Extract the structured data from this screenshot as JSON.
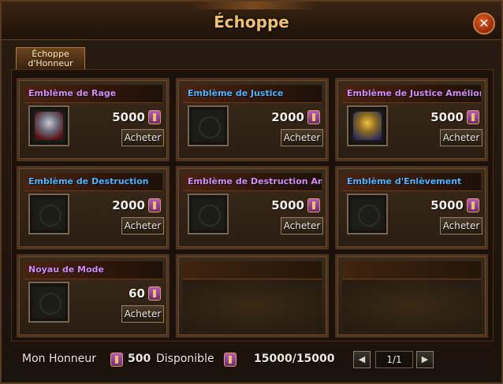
{
  "window": {
    "title": "Échoppe",
    "close_label": "✕"
  },
  "tab": {
    "line1": "Échoppe",
    "line2": "d'Honneur"
  },
  "buy_label": "Acheter",
  "items": [
    {
      "name": "Emblème de Rage",
      "color": "#d48cf8",
      "price": "5000",
      "icon": "rage-emblem-icon"
    },
    {
      "name": "Emblème de Justice",
      "color": "#4fb4ff",
      "price": "2000",
      "icon": "empty-slot-icon"
    },
    {
      "name": "Emblème de Justice Amélioré",
      "color": "#d48cf8",
      "price": "5000",
      "icon": "justice-scales-emblem-icon"
    },
    {
      "name": "Emblème de Destruction",
      "color": "#4fb4ff",
      "price": "2000",
      "icon": "empty-slot-icon"
    },
    {
      "name": "Emblème de Destruction Amélior",
      "color": "#d48cf8",
      "price": "5000",
      "icon": "empty-slot-icon"
    },
    {
      "name": "Emblème d'Enlèvement",
      "color": "#4fb4ff",
      "price": "5000",
      "icon": "empty-slot-icon"
    },
    {
      "name": "Noyau de Mode",
      "color": "#d48cf8",
      "price": "60",
      "icon": "empty-slot-icon"
    }
  ],
  "footer": {
    "honor_label": "Mon Honneur",
    "honor_value": "500",
    "available_label": "Disponible",
    "available_value": "15000/15000",
    "page": "1/1",
    "prev_label": "◀",
    "next_label": "▶"
  }
}
